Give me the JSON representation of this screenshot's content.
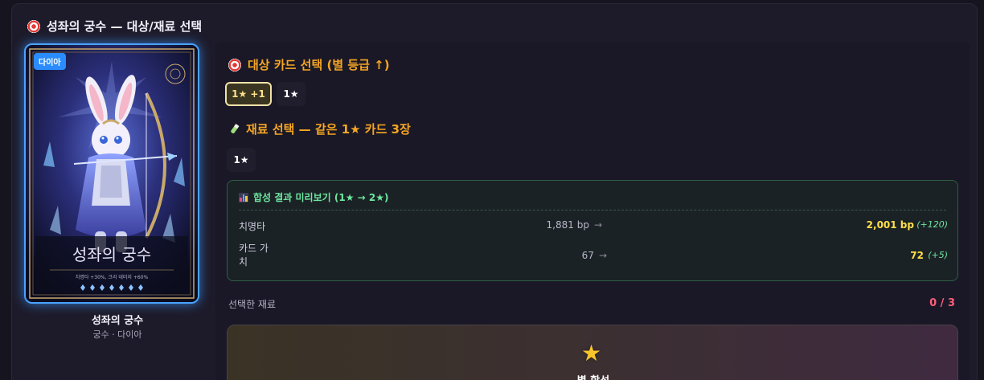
{
  "panel": {
    "title": "성좌의 궁수 — 대상/재료 선택"
  },
  "card": {
    "rarity": "다이아",
    "name": "성좌의 궁수",
    "subtitle": "궁수 · 다이아",
    "art_title": "성좌의 궁수",
    "art_effect": "치명타 +30%, 크리 데미지 +60%"
  },
  "target": {
    "title": "대상 카드 선택 (별 등급 ↑)",
    "options": [
      {
        "label": "1★ +1",
        "selected": true
      },
      {
        "label": "1★",
        "selected": false
      }
    ]
  },
  "material": {
    "title": "재료 선택 — 같은 1★ 카드 3장",
    "options": [
      {
        "label": "1★"
      }
    ]
  },
  "preview": {
    "title": "합성 결과 미리보기 (1★ → 2★)",
    "rows": [
      {
        "label": "치명타",
        "old": "1,881 bp",
        "arrow": "→",
        "new": "2,001 bp",
        "delta": "(+120)"
      },
      {
        "label": "카드 가\n치",
        "old": "67",
        "arrow": "→",
        "new": "72",
        "delta": "(+5)"
      }
    ]
  },
  "selection": {
    "label": "선택한 재료",
    "count": "0 / 3"
  },
  "synth_button": {
    "label": "별 합성"
  },
  "colors": {
    "accent_gold": "#f5a623",
    "accent_green": "#6ee7a0",
    "accent_red": "#ff5d7a",
    "diamond_blue": "#2a8cff"
  }
}
